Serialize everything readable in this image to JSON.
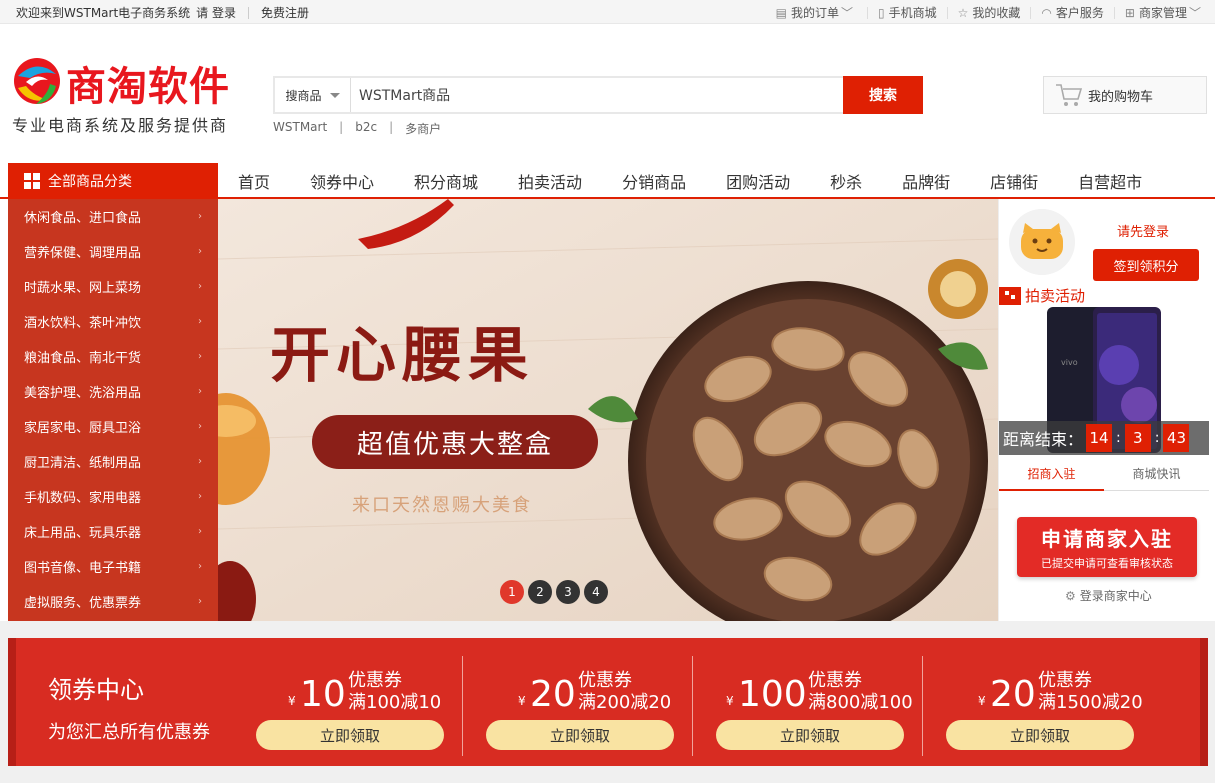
{
  "topbar": {
    "welcome": "欢迎来到WSTMart电子商务系统",
    "login": "请 登录",
    "register": "免费注册",
    "links": [
      {
        "label": "我的订单",
        "icon": "order-icon"
      },
      {
        "label": "手机商城",
        "icon": "mobile-icon"
      },
      {
        "label": "我的收藏",
        "icon": "star-icon"
      },
      {
        "label": "客户服务",
        "icon": "headset-icon"
      },
      {
        "label": "商家管理",
        "icon": "grid-icon"
      }
    ]
  },
  "logo": {
    "name": "商淘软件",
    "slogan": "专业电商系统及服务提供商"
  },
  "search": {
    "category": "搜商品",
    "value": "WSTMart商品",
    "button": "搜索",
    "hotwords": [
      "WSTMart",
      "b2c",
      "多商户"
    ]
  },
  "cart": {
    "label": "我的购物车"
  },
  "nav": {
    "all_categories": "全部商品分类",
    "items": [
      "首页",
      "领券中心",
      "积分商城",
      "拍卖活动",
      "分销商品",
      "团购活动",
      "秒杀",
      "品牌街",
      "店铺街",
      "自营超市"
    ]
  },
  "categories": [
    "休闲食品、进口食品",
    "营养保健、调理用品",
    "时蔬水果、网上菜场",
    "酒水饮料、茶叶冲饮",
    "粮油食品、南北干货",
    "美容护理、洗浴用品",
    "家居家电、厨具卫浴",
    "厨卫清洁、纸制用品",
    "手机数码、家用电器",
    "床上用品、玩具乐器",
    "图书音像、电子书籍",
    "虚拟服务、优惠票券"
  ],
  "banner": {
    "title": "开心腰果",
    "pill": "超值优惠大整盒",
    "sub": "来口天然恩赐大美食",
    "pages": [
      "1",
      "2",
      "3",
      "4"
    ],
    "active_page": 1
  },
  "user_panel": {
    "login_prompt": "请先登录",
    "sign_button": "签到领积分",
    "auction_label": "拍卖活动",
    "countdown_label": "距离结束：",
    "countdown": [
      "14",
      "3",
      "43"
    ],
    "tabs": [
      "招商入驻",
      "商城快讯"
    ],
    "merchant_button": "申请商家入驻",
    "merchant_sub": "已提交申请可查看审核状态",
    "merchant_login": "登录商家中心"
  },
  "coupon_center": {
    "title": "领券中心",
    "subtitle": "为您汇总所有优惠券",
    "currency": "¥",
    "coupon_label": "优惠券",
    "get_label": "立即领取",
    "coupons": [
      {
        "amount": "10",
        "condition": "满100减10"
      },
      {
        "amount": "20",
        "condition": "满200减20"
      },
      {
        "amount": "100",
        "condition": "满800减100"
      },
      {
        "amount": "20",
        "condition": "满1500减20"
      }
    ]
  },
  "colors": {
    "brand_red": "#df2003",
    "sidebar_red": "#c7361f",
    "coupon_red": "#d82c22",
    "coupon_button": "#f9e3a2"
  }
}
